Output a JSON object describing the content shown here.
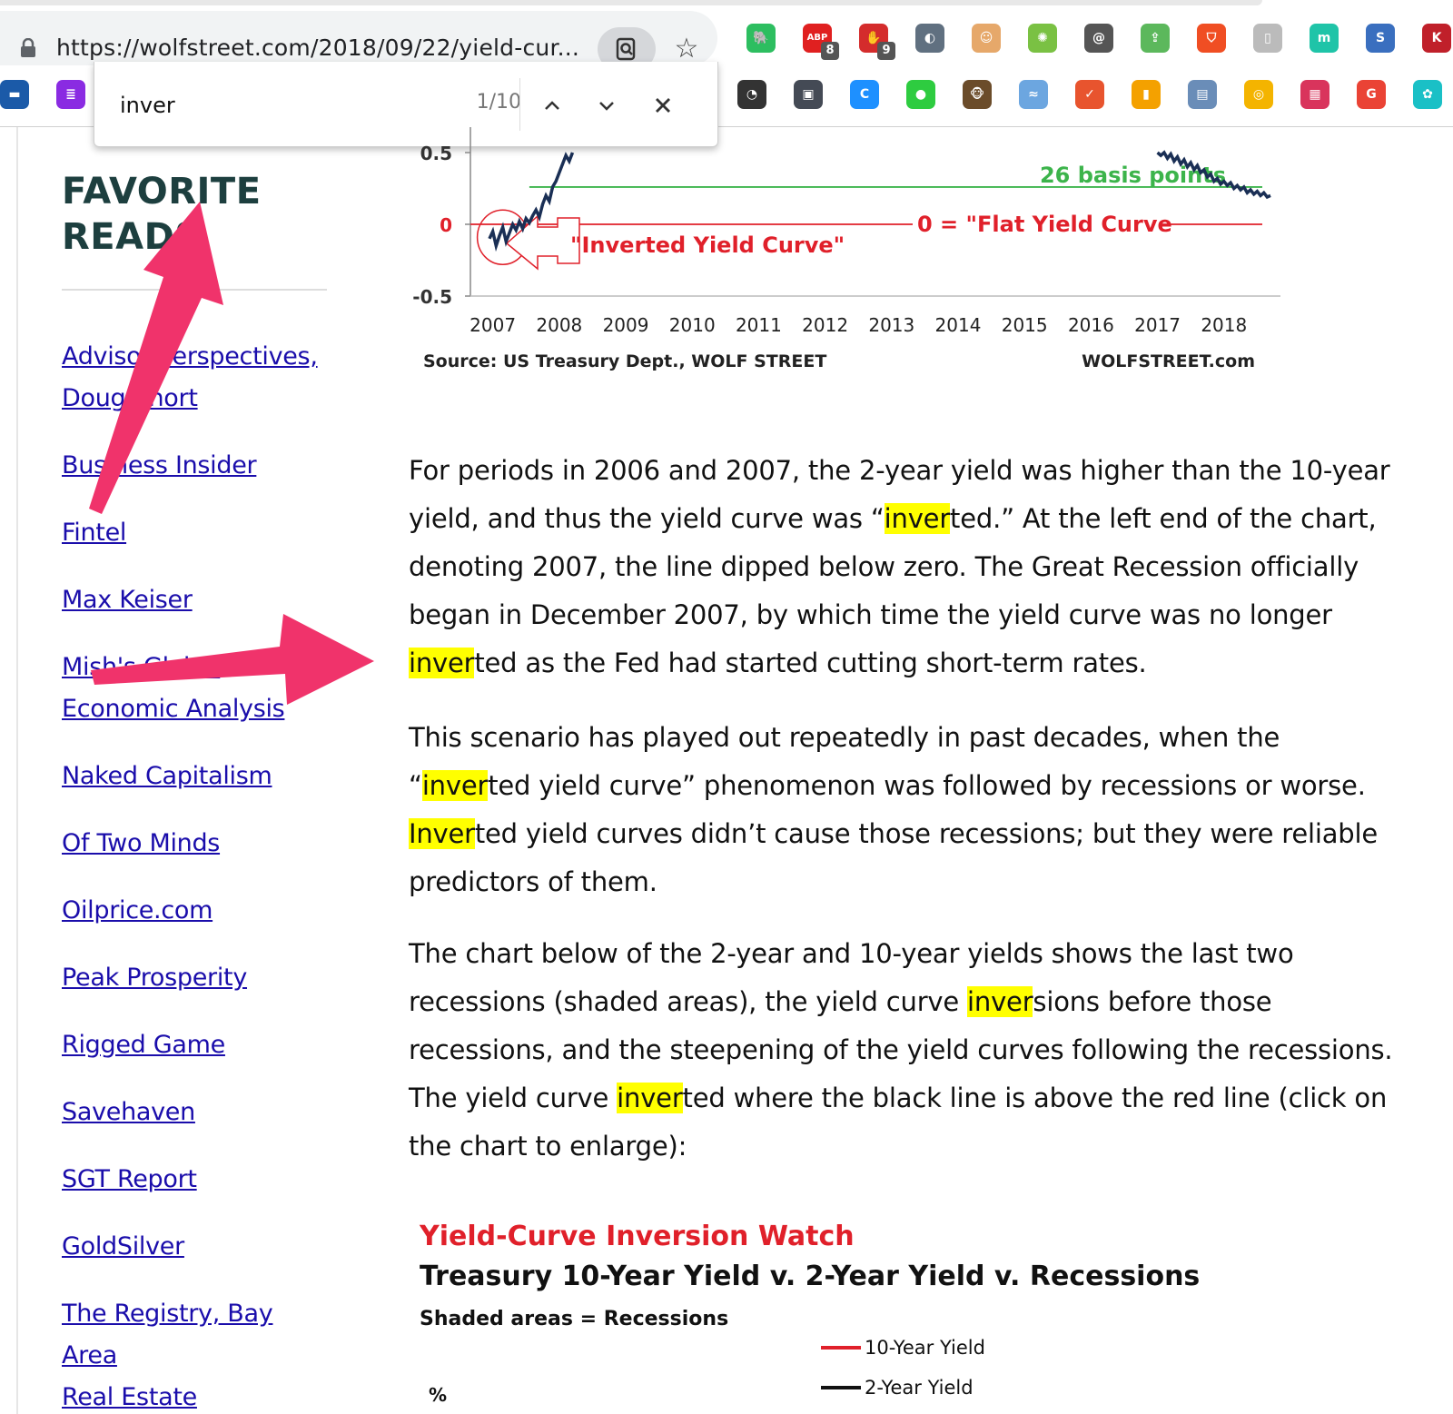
{
  "browser": {
    "url": "https://wolfstreet.com/2018/09/22/yield-cur...",
    "extensions": [
      {
        "name": "evernote-icon",
        "color": "#2dbe60",
        "glyph": "🐘"
      },
      {
        "name": "adblock-icon",
        "color": "#e02020",
        "glyph": "ABP",
        "badge": "8"
      },
      {
        "name": "stop-hand-icon",
        "color": "#d42c2c",
        "glyph": "✋",
        "badge": "9"
      },
      {
        "name": "half-moon-icon",
        "color": "#607080",
        "glyph": "◐"
      },
      {
        "name": "face-icon",
        "color": "#e6a86a",
        "glyph": "☺"
      },
      {
        "name": "color-wheel-icon",
        "color": "#7ac143",
        "glyph": "✺"
      },
      {
        "name": "at-sign-icon",
        "color": "#555555",
        "glyph": "@"
      },
      {
        "name": "green-arrow-icon",
        "color": "#5cb85c",
        "glyph": "⇪"
      },
      {
        "name": "shield-icon",
        "color": "#f04e23",
        "glyph": "⛉"
      },
      {
        "name": "document-icon",
        "color": "#bbbbbb",
        "glyph": "▯"
      },
      {
        "name": "teal-circle-icon",
        "color": "#1fc4a8",
        "glyph": "m"
      },
      {
        "name": "s-icon",
        "color": "#3a6fbf",
        "glyph": "S"
      },
      {
        "name": "k-icon",
        "color": "#c0202a",
        "glyph": "K"
      }
    ],
    "bookmarks": [
      {
        "name": "bank-icon",
        "color": "#1b5aa8",
        "glyph": "▬"
      },
      {
        "name": "list-icon",
        "color": "#8a2be2",
        "glyph": "≣"
      },
      {
        "name": "gauge-icon",
        "color": "#333333",
        "glyph": "◔"
      },
      {
        "name": "save-icon",
        "color": "#444a55",
        "glyph": "▣"
      },
      {
        "name": "c-icon",
        "color": "#1e90ff",
        "glyph": "C"
      },
      {
        "name": "green-dot-icon",
        "color": "#2ecc40",
        "glyph": "●"
      },
      {
        "name": "mailchimp-icon",
        "color": "#6b4c2a",
        "glyph": "🐵"
      },
      {
        "name": "rss-icon",
        "color": "#6ca6e0",
        "glyph": "≈"
      },
      {
        "name": "check-icon",
        "color": "#e8542e",
        "glyph": "✓"
      },
      {
        "name": "bar-chart-icon",
        "color": "#f4a100",
        "glyph": "▮"
      },
      {
        "name": "briefcase-icon",
        "color": "#6a8db8",
        "glyph": "▤"
      },
      {
        "name": "chrome-icon",
        "color": "#f4b400",
        "glyph": "◎"
      },
      {
        "name": "color-grid-icon",
        "color": "#d9345c",
        "glyph": "▦"
      },
      {
        "name": "g-icon",
        "color": "#ea4335",
        "glyph": "G"
      },
      {
        "name": "swirl-icon",
        "color": "#1ac0c6",
        "glyph": "✿"
      }
    ]
  },
  "find": {
    "query": "inver",
    "count": "1/10"
  },
  "sidebar": {
    "title_line1": "FAVORITE",
    "title_line2": "READS",
    "links": [
      {
        "lines": [
          "Advisor Perspectives,",
          "Doug Short"
        ]
      },
      {
        "lines": [
          "Business Insider"
        ]
      },
      {
        "lines": [
          "Fintel"
        ]
      },
      {
        "lines": [
          "Max Keiser"
        ]
      },
      {
        "lines": [
          "Mish's Global",
          "Economic Analysis"
        ]
      },
      {
        "lines": [
          "Naked Capitalism"
        ]
      },
      {
        "lines": [
          "Of Two Minds"
        ]
      },
      {
        "lines": [
          "Oilprice.com"
        ]
      },
      {
        "lines": [
          "Peak Prosperity"
        ]
      },
      {
        "lines": [
          "Rigged Game"
        ]
      },
      {
        "lines": [
          "Savehaven"
        ]
      },
      {
        "lines": [
          "SGT Report"
        ]
      },
      {
        "lines": [
          "GoldSilver"
        ]
      },
      {
        "lines": [
          "The Registry, Bay Area",
          "Real Estate"
        ]
      }
    ]
  },
  "chart_data": [
    {
      "type": "line",
      "title": "",
      "xlabel": "",
      "ylabel": "",
      "x_ticks": [
        "2007",
        "2008",
        "2009",
        "2010",
        "2011",
        "2012",
        "2013",
        "2014",
        "2015",
        "2016",
        "2017",
        "2018"
      ],
      "y_ticks": [
        "0.5",
        "0",
        "-0.5"
      ],
      "ylim": [
        -0.5,
        0.5
      ],
      "series": [
        {
          "color": "#1a2f55",
          "x": [
            2006.95,
            2007.0,
            2007.05,
            2007.1,
            2007.15,
            2007.2,
            2007.25,
            2007.3,
            2007.35,
            2007.4,
            2007.45,
            2007.5,
            2007.55,
            2007.6,
            2007.65,
            2007.7,
            2007.75,
            2007.8,
            2007.85,
            2007.9,
            2007.95,
            2008.0,
            2008.05,
            2008.1,
            2008.15,
            2008.2,
            2017.0,
            2017.05,
            2017.1,
            2017.15,
            2017.2,
            2017.25,
            2017.3,
            2017.35,
            2017.4,
            2017.45,
            2017.5,
            2017.55,
            2017.6,
            2017.65,
            2017.7,
            2017.75,
            2017.8,
            2017.85,
            2017.9,
            2017.95,
            2018.0,
            2018.05,
            2018.1,
            2018.15,
            2018.2,
            2018.25,
            2018.3,
            2018.35,
            2018.4,
            2018.45,
            2018.5,
            2018.55,
            2018.6,
            2018.65,
            2018.7
          ],
          "y": [
            -0.1,
            -0.05,
            -0.15,
            -0.08,
            -0.02,
            -0.12,
            -0.06,
            0.0,
            -0.04,
            0.02,
            -0.03,
            0.04,
            0.01,
            0.06,
            0.1,
            0.05,
            0.14,
            0.2,
            0.16,
            0.26,
            0.3,
            0.36,
            0.42,
            0.48,
            0.44,
            0.5,
            0.5,
            0.48,
            0.5,
            0.46,
            0.49,
            0.44,
            0.47,
            0.42,
            0.45,
            0.4,
            0.43,
            0.38,
            0.41,
            0.36,
            0.38,
            0.33,
            0.35,
            0.3,
            0.32,
            0.28,
            0.3,
            0.27,
            0.29,
            0.25,
            0.27,
            0.24,
            0.26,
            0.22,
            0.24,
            0.21,
            0.23,
            0.2,
            0.22,
            0.19,
            0.2
          ]
        }
      ],
      "reference_lines": [
        {
          "y": 0.26,
          "color": "#3cb44b",
          "label": "26 basis points"
        },
        {
          "y": 0,
          "color": "#e0202a",
          "label": "0 = \"Flat Yield Curve"
        }
      ],
      "annotations": [
        {
          "text": "\"Inverted Yield Curve\"",
          "color": "#e0202a"
        }
      ],
      "source": "Source: US Treasury Dept., WOLF STREET",
      "brand": "WOLFSTREET.com"
    },
    {
      "type": "line",
      "title": "Yield-Curve Inversion Watch",
      "subtitle": "Treasury 10-Year Yield v. 2-Year Yield v. Recessions",
      "note": "Shaded areas = Recessions",
      "ylabel": "%",
      "series": [
        {
          "name": "10-Year Yield",
          "color": "#e0202a"
        },
        {
          "name": "2-Year Yield",
          "color": "#111111"
        }
      ]
    }
  ],
  "article": {
    "paragraphs": [
      [
        {
          "t": "For periods in 2006 and 2007, the 2-year yield was higher than the 10-year yield, and thus the yield curve was “"
        },
        {
          "t": "inver",
          "hl": true
        },
        {
          "t": "ted.” At the left end of the chart, denoting 2007, the line dipped below zero. The Great Recession officially began in December 2007, by which time the yield curve was no longer "
        },
        {
          "t": "inver",
          "hl": true
        },
        {
          "t": "ted as the Fed had started cutting short-term rates."
        }
      ],
      [
        {
          "t": "This scenario has played out repeatedly in past decades, when the “"
        },
        {
          "t": "inver",
          "hl": true
        },
        {
          "t": "ted yield curve” phenomenon was followed by recessions or worse. "
        },
        {
          "t": "Inver",
          "hl": true
        },
        {
          "t": "ted yield curves didn’t cause those recessions; but they were reliable predictors of them."
        }
      ],
      [
        {
          "t": "The chart below of the 2-year and 10-year yields shows the last two recessions (shaded areas), the yield curve "
        },
        {
          "t": "inver",
          "hl": true
        },
        {
          "t": "sions before those recessions, and the steepening of the yield curves following the recessions. The yield curve "
        },
        {
          "t": "inver",
          "hl": true
        },
        {
          "t": "ted where the black line is above the red line (click on the chart to enlarge):"
        }
      ]
    ]
  },
  "colors": {
    "arrow": "#f0336b",
    "highlight": "#ffff00",
    "link": "#1a0dab"
  }
}
